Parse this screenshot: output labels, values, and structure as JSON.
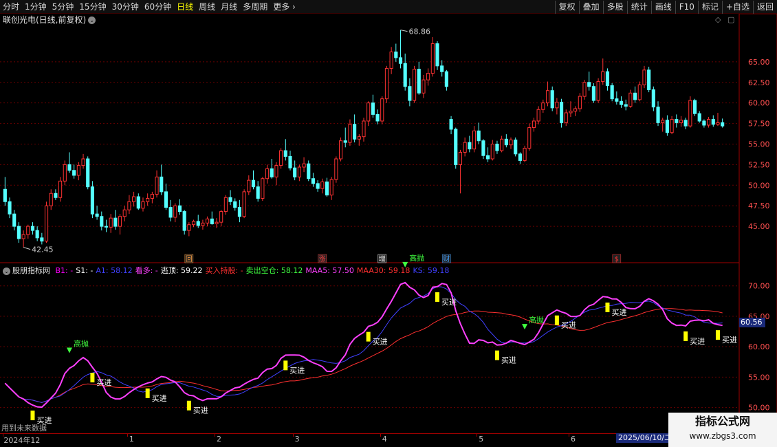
{
  "toolbar": {
    "periods": [
      {
        "label": "分时",
        "active": false
      },
      {
        "label": "1分钟",
        "active": false
      },
      {
        "label": "5分钟",
        "active": false
      },
      {
        "label": "15分钟",
        "active": false
      },
      {
        "label": "30分钟",
        "active": false
      },
      {
        "label": "60分钟",
        "active": false
      },
      {
        "label": "日线",
        "active": true
      },
      {
        "label": "周线",
        "active": false
      },
      {
        "label": "月线",
        "active": false
      },
      {
        "label": "多周期",
        "active": false
      },
      {
        "label": "更多",
        "active": false
      }
    ],
    "tools": [
      "复权",
      "叠加",
      "多股",
      "统计",
      "画线",
      "F10",
      "标记",
      "+自选",
      "返回"
    ]
  },
  "stock": {
    "title": "联创光电(日线,前复权)",
    "high_label": "68.86",
    "low_label": "42.45"
  },
  "events": [
    {
      "label": "回",
      "color": "#ffa040"
    },
    {
      "label": "涨",
      "color": "#ff4040"
    },
    {
      "label": "增",
      "color": "#ffffff"
    },
    {
      "label": "财",
      "color": "#40a0ff"
    },
    {
      "label": "$",
      "color": "#ff3030"
    }
  ],
  "indicator": {
    "name": "股朋指标网",
    "legend": [
      {
        "text": "B1: -",
        "color": "#ff00ff"
      },
      {
        "text": "S1: -",
        "color": "#ffffff"
      },
      {
        "text": "A1: 58.12",
        "color": "#4040ff"
      },
      {
        "text": "看多: -",
        "color": "#ff40ff"
      },
      {
        "text": "逃顶: 59.22",
        "color": "#ffffff"
      },
      {
        "text": "买入持股: -",
        "color": "#ff3030"
      },
      {
        "text": "卖出空仓: 58.12",
        "color": "#40ff40"
      },
      {
        "text": "MAA5: 57.50",
        "color": "#ff40ff"
      },
      {
        "text": "MAA30: 59.18",
        "color": "#ff3030"
      },
      {
        "text": "KS: 59.18",
        "color": "#4040ff"
      }
    ],
    "value_badge": "60.56",
    "buy_label": "买进",
    "sell_label": "高抛"
  },
  "note": "用到未来数据",
  "time_axis": {
    "labels": [
      "2024年12",
      "1",
      "2",
      "3",
      "4",
      "5",
      "6"
    ],
    "date_badge": "2025/06/10/二"
  },
  "watermark": {
    "title": "指标公式网",
    "url": "www.zbgs3.com"
  },
  "chart_data": {
    "type": "candlestick",
    "title": "联创光电(日线,前复权)",
    "price_axis": {
      "min": 42,
      "max": 69,
      "ticks": [
        45.0,
        47.5,
        50.0,
        52.5,
        55.0,
        57.5,
        60.0,
        62.5,
        65.0
      ]
    },
    "indicator_axis": {
      "min": 46,
      "max": 72,
      "ticks": [
        50.0,
        55.0,
        60.0,
        65.0,
        70.0
      ]
    },
    "ohlc": [
      [
        49.5,
        51.0,
        47.5,
        48.0
      ],
      [
        48.0,
        48.5,
        46.0,
        46.5
      ],
      [
        46.5,
        47.0,
        44.5,
        45.0
      ],
      [
        45.0,
        45.5,
        43.0,
        43.5
      ],
      [
        43.5,
        44.5,
        42.45,
        44.0
      ],
      [
        44.0,
        45.2,
        43.5,
        45.0
      ],
      [
        45.0,
        45.5,
        44.0,
        44.5
      ],
      [
        44.5,
        45.0,
        43.2,
        43.6
      ],
      [
        43.6,
        44.2,
        42.8,
        43.2
      ],
      [
        43.2,
        48.0,
        43.0,
        47.5
      ],
      [
        47.5,
        49.5,
        47.0,
        49.0
      ],
      [
        49.0,
        49.5,
        48.2,
        48.5
      ],
      [
        48.5,
        51.0,
        48.0,
        50.5
      ],
      [
        50.5,
        53.0,
        50.0,
        52.5
      ],
      [
        52.5,
        54.0,
        51.5,
        51.8
      ],
      [
        51.8,
        52.5,
        50.8,
        51.2
      ],
      [
        51.2,
        52.8,
        50.6,
        52.4
      ],
      [
        52.4,
        53.8,
        52.0,
        53.2
      ],
      [
        53.2,
        53.5,
        49.5,
        49.8
      ],
      [
        49.8,
        50.5,
        46.0,
        46.5
      ],
      [
        46.5,
        47.5,
        45.8,
        46.2
      ],
      [
        46.2,
        46.8,
        44.5,
        45.0
      ],
      [
        45.0,
        45.8,
        44.3,
        44.9
      ],
      [
        44.9,
        46.5,
        44.2,
        46.0
      ],
      [
        46.0,
        47.0,
        44.6,
        45.0
      ],
      [
        45.0,
        46.5,
        44.0,
        46.2
      ],
      [
        46.2,
        47.5,
        45.6,
        47.0
      ],
      [
        47.0,
        48.8,
        46.5,
        48.0
      ],
      [
        48.0,
        49.2,
        47.4,
        48.6
      ],
      [
        48.6,
        49.0,
        47.0,
        47.2
      ],
      [
        47.2,
        48.5,
        46.8,
        48.0
      ],
      [
        48.0,
        49.0,
        47.5,
        48.4
      ],
      [
        48.4,
        49.2,
        47.8,
        48.9
      ],
      [
        48.9,
        51.8,
        48.5,
        51.0
      ],
      [
        51.0,
        52.5,
        48.8,
        49.2
      ],
      [
        49.2,
        50.2,
        47.0,
        47.3
      ],
      [
        47.3,
        48.2,
        45.6,
        46.1
      ],
      [
        46.1,
        47.8,
        45.5,
        47.5
      ],
      [
        47.5,
        48.3,
        46.4,
        46.8
      ],
      [
        46.8,
        47.0,
        44.0,
        44.5
      ],
      [
        44.5,
        45.5,
        43.8,
        45.2
      ],
      [
        45.2,
        45.8,
        44.9,
        45.6
      ],
      [
        45.6,
        46.4,
        44.8,
        45.1
      ],
      [
        45.1,
        45.8,
        44.6,
        45.4
      ],
      [
        45.4,
        46.2,
        45.0,
        45.9
      ],
      [
        45.9,
        46.8,
        45.2,
        45.3
      ],
      [
        45.3,
        46.0,
        44.8,
        45.5
      ],
      [
        45.5,
        47.0,
        45.0,
        46.8
      ],
      [
        46.8,
        48.8,
        46.4,
        48.5
      ],
      [
        48.5,
        49.4,
        47.6,
        48.0
      ],
      [
        48.0,
        48.4,
        46.9,
        47.3
      ],
      [
        47.3,
        48.2,
        45.5,
        46.2
      ],
      [
        46.2,
        49.5,
        46.0,
        49.2
      ],
      [
        49.2,
        51.2,
        48.8,
        50.6
      ],
      [
        50.6,
        51.8,
        49.5,
        49.8
      ],
      [
        49.8,
        50.5,
        48.0,
        48.4
      ],
      [
        48.4,
        51.0,
        48.1,
        50.8
      ],
      [
        50.8,
        52.5,
        50.2,
        52.0
      ],
      [
        52.0,
        53.2,
        50.8,
        51.0
      ],
      [
        51.0,
        52.8,
        50.0,
        52.4
      ],
      [
        52.4,
        54.5,
        52.0,
        54.2
      ],
      [
        54.2,
        55.6,
        53.0,
        53.5
      ],
      [
        53.5,
        54.2,
        51.8,
        52.1
      ],
      [
        52.1,
        53.0,
        50.6,
        51.0
      ],
      [
        51.0,
        52.5,
        50.5,
        52.2
      ],
      [
        52.2,
        53.4,
        51.6,
        52.6
      ],
      [
        52.6,
        53.0,
        50.5,
        50.8
      ],
      [
        50.8,
        51.5,
        49.8,
        50.2
      ],
      [
        50.2,
        50.6,
        49.2,
        49.6
      ],
      [
        49.6,
        50.8,
        49.0,
        50.4
      ],
      [
        50.4,
        50.9,
        48.6,
        48.8
      ],
      [
        48.8,
        51.0,
        48.2,
        50.7
      ],
      [
        50.7,
        53.5,
        50.3,
        53.2
      ],
      [
        53.2,
        55.8,
        52.9,
        55.4
      ],
      [
        55.4,
        57.0,
        54.6,
        55.2
      ],
      [
        55.2,
        58.0,
        54.8,
        57.4
      ],
      [
        57.4,
        58.6,
        55.2,
        55.6
      ],
      [
        55.6,
        56.2,
        54.8,
        55.9
      ],
      [
        55.9,
        58.2,
        55.3,
        57.8
      ],
      [
        57.8,
        60.2,
        57.2,
        60.0
      ],
      [
        60.0,
        61.0,
        58.2,
        58.6
      ],
      [
        58.6,
        59.2,
        57.4,
        57.8
      ],
      [
        57.8,
        60.8,
        57.4,
        60.5
      ],
      [
        60.5,
        64.5,
        60.0,
        64.2
      ],
      [
        64.2,
        66.8,
        63.5,
        66.2
      ],
      [
        66.2,
        67.2,
        65.0,
        65.5
      ],
      [
        65.5,
        68.86,
        64.2,
        64.8
      ],
      [
        64.8,
        66.0,
        61.5,
        62.0
      ],
      [
        62.0,
        63.0,
        59.6,
        60.3
      ],
      [
        60.3,
        64.5,
        60.0,
        64.1
      ],
      [
        64.1,
        65.0,
        61.0,
        61.2
      ],
      [
        61.2,
        63.4,
        60.6,
        62.8
      ],
      [
        62.8,
        64.2,
        62.1,
        63.6
      ],
      [
        63.6,
        68.0,
        63.2,
        67.2
      ],
      [
        67.2,
        67.5,
        64.0,
        64.5
      ],
      [
        64.5,
        65.2,
        63.2,
        63.8
      ],
      [
        63.8,
        64.0,
        61.5,
        62.0
      ],
      [
        58.0,
        58.4,
        56.2,
        56.8
      ],
      [
        56.8,
        57.0,
        52.0,
        52.5
      ],
      [
        52.5,
        54.3,
        49.0,
        54.0
      ],
      [
        54.0,
        55.8,
        53.5,
        55.2
      ],
      [
        55.2,
        56.0,
        54.0,
        54.4
      ],
      [
        54.4,
        57.2,
        54.0,
        56.6
      ],
      [
        56.6,
        57.6,
        55.0,
        55.4
      ],
      [
        55.4,
        55.6,
        53.2,
        53.6
      ],
      [
        53.6,
        54.6,
        52.8,
        53.2
      ],
      [
        53.2,
        55.5,
        53.0,
        55.0
      ],
      [
        55.0,
        55.4,
        53.8,
        54.2
      ],
      [
        54.2,
        56.0,
        54.0,
        55.6
      ],
      [
        55.6,
        56.2,
        54.6,
        54.9
      ],
      [
        54.9,
        55.8,
        54.4,
        55.5
      ],
      [
        55.5,
        55.8,
        53.5,
        53.8
      ],
      [
        53.8,
        54.0,
        52.6,
        53.0
      ],
      [
        53.0,
        54.8,
        52.8,
        54.5
      ],
      [
        54.5,
        57.5,
        54.2,
        57.0
      ],
      [
        57.0,
        58.2,
        56.5,
        57.8
      ],
      [
        57.8,
        59.6,
        57.4,
        59.2
      ],
      [
        59.2,
        60.4,
        58.8,
        60.0
      ],
      [
        60.0,
        62.6,
        59.6,
        61.5
      ],
      [
        61.5,
        62.0,
        59.0,
        59.4
      ],
      [
        59.4,
        60.6,
        58.6,
        60.1
      ],
      [
        60.1,
        60.5,
        57.0,
        57.6
      ],
      [
        57.6,
        59.2,
        57.2,
        58.8
      ],
      [
        58.8,
        60.2,
        58.3,
        59.0
      ],
      [
        59.0,
        59.6,
        58.4,
        59.3
      ],
      [
        59.3,
        61.2,
        58.9,
        60.8
      ],
      [
        60.8,
        62.8,
        60.4,
        62.5
      ],
      [
        62.5,
        63.8,
        61.5,
        62.0
      ],
      [
        62.0,
        62.4,
        60.0,
        60.3
      ],
      [
        60.3,
        63.0,
        60.0,
        62.6
      ],
      [
        62.6,
        65.4,
        62.2,
        63.8
      ],
      [
        63.8,
        64.2,
        61.5,
        62.1
      ],
      [
        62.1,
        62.4,
        60.2,
        60.5
      ],
      [
        60.5,
        61.4,
        59.8,
        60.2
      ],
      [
        60.2,
        60.8,
        59.4,
        59.8
      ],
      [
        59.8,
        60.4,
        59.1,
        59.6
      ],
      [
        59.6,
        61.6,
        59.4,
        61.2
      ],
      [
        61.2,
        62.0,
        60.0,
        60.4
      ],
      [
        60.4,
        62.6,
        60.2,
        62.2
      ],
      [
        62.2,
        64.5,
        61.8,
        64.0
      ],
      [
        64.0,
        64.4,
        61.3,
        61.6
      ],
      [
        61.6,
        62.0,
        59.0,
        59.5
      ],
      [
        59.5,
        60.2,
        57.2,
        57.6
      ],
      [
        57.6,
        58.2,
        56.5,
        57.9
      ],
      [
        57.9,
        58.5,
        56.0,
        56.4
      ],
      [
        56.4,
        58.4,
        56.2,
        58.0
      ],
      [
        58.0,
        58.6,
        57.0,
        57.6
      ],
      [
        57.6,
        58.4,
        57.1,
        57.9
      ],
      [
        57.9,
        58.2,
        56.8,
        57.2
      ],
      [
        57.2,
        60.8,
        57.0,
        60.3
      ],
      [
        60.3,
        60.5,
        58.4,
        58.7
      ],
      [
        58.7,
        59.0,
        57.6,
        57.8
      ],
      [
        57.8,
        58.0,
        57.0,
        57.3
      ],
      [
        57.3,
        58.3,
        57.0,
        58.0
      ],
      [
        58.0,
        58.5,
        57.1,
        57.4
      ],
      [
        57.4,
        58.8,
        57.2,
        57.6
      ],
      [
        57.6,
        58.1,
        57.0,
        57.2
      ]
    ],
    "series": [
      {
        "name": "MAA5",
        "color": "#ff40ff"
      },
      {
        "name": "MAA30",
        "color": "#ff3030"
      },
      {
        "name": "KS",
        "color": "#4040ff"
      }
    ]
  }
}
